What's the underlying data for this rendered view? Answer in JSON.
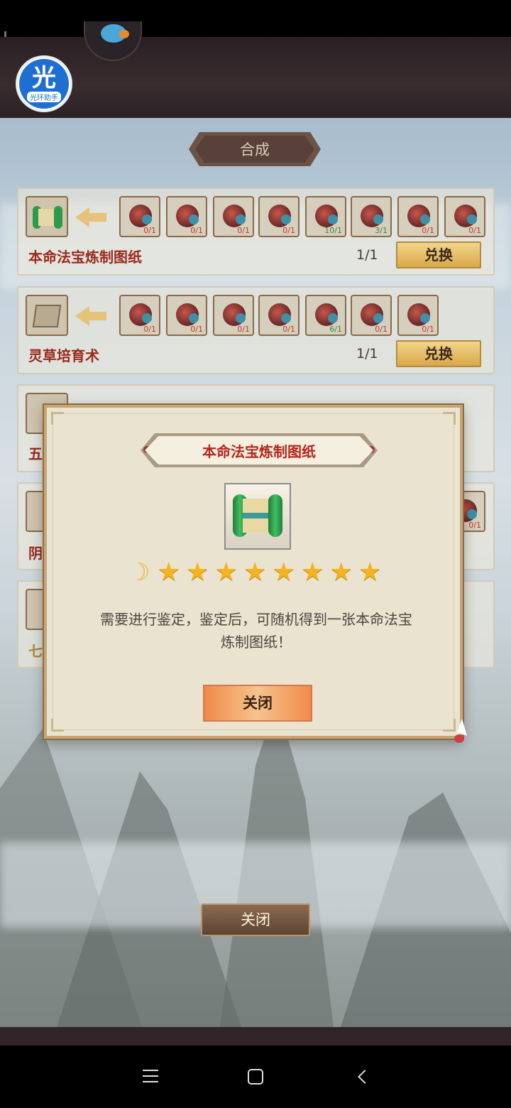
{
  "panel": {
    "title": "合成"
  },
  "recipes": [
    {
      "name": "本命法宝炼制图纸",
      "count": "1/1",
      "exchange_label": "兑换",
      "slots": [
        "0/1",
        "0/1",
        "0/1",
        "0/1",
        "10/1",
        "3/1",
        "0/1",
        "0/1"
      ]
    },
    {
      "name": "灵草培育术",
      "count": "1/1",
      "exchange_label": "兑换",
      "slots": [
        "0/1",
        "0/1",
        "0/1",
        "0/1",
        "6/1",
        "0/1",
        "0/1"
      ]
    },
    {
      "name": "五"
    },
    {
      "name": "阴",
      "slots": [
        "0/1"
      ]
    },
    {
      "name": "七"
    }
  ],
  "bottom_close_label": "关闭",
  "dialog": {
    "title": "本命法宝炼制图纸",
    "moon": "☽",
    "stars": 8,
    "star_glyph": "★",
    "description_line1": "需要进行鉴定，鉴定后，可随机得到一张本命法宝",
    "description_line2": "炼制图纸！",
    "close_label": "关闭"
  },
  "helper_logo": {
    "glyph": "光",
    "caption": "光环助手"
  },
  "colors": {
    "title_red": "#b2281c",
    "star": "#f2b51f",
    "accent_orange": "#f08a4a"
  }
}
